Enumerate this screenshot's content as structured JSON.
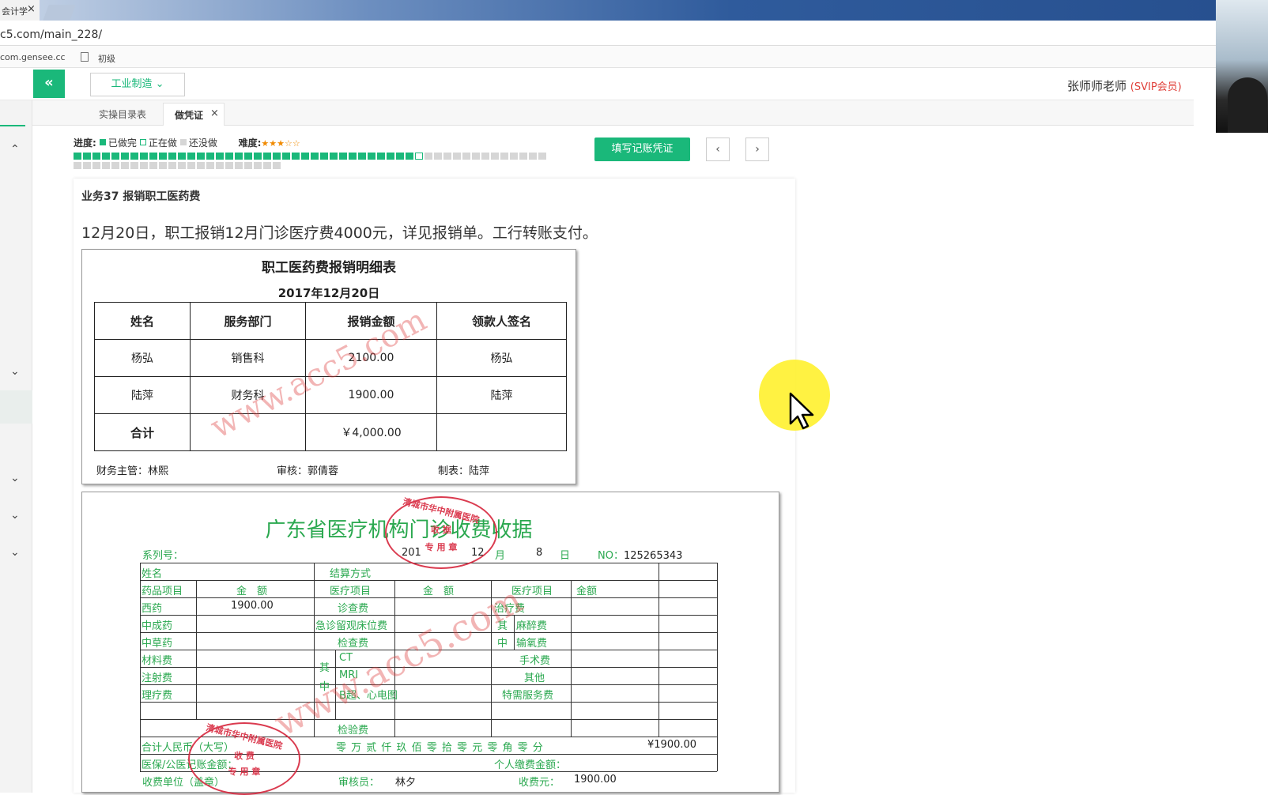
{
  "browser": {
    "tab_title": "会计学",
    "tab_close": "×",
    "url": "c5.com/main_228/",
    "bookmarks": [
      "com.gensee.cc",
      "初级"
    ]
  },
  "header": {
    "collapse_icon": "«",
    "industry": "工业制造",
    "teacher": "张师师老师",
    "vip": "(SVIP会员)"
  },
  "tabs": [
    {
      "label": "实操目录表"
    },
    {
      "label": "做凭证",
      "close": "×"
    }
  ],
  "progress": {
    "label": "进度:",
    "done": "已做完",
    "doing": "正在做",
    "todo": "还没做",
    "difficulty_label": "难度:",
    "difficulty_stars": "★★★☆☆",
    "total_cells": 72,
    "done_cells": 36,
    "current_cell": 37,
    "colors": {
      "done": "#1ab87a",
      "doing": "#ffffff",
      "todo": "#d6d6d6"
    }
  },
  "actions": {
    "fill_voucher": "填写记账凭证",
    "prev": "‹",
    "next": "›"
  },
  "task": {
    "title": "业务37 报销职工医药费",
    "description": "12月20日，职工报销12月门诊医疗费4000元，详见报销单。工行转账支付。"
  },
  "reimbursement_form": {
    "title": "职工医药费报销明细表",
    "date": "2017年12月20日",
    "headers": [
      "姓名",
      "服务部门",
      "报销金额",
      "领款人签名"
    ],
    "rows": [
      {
        "name": "杨弘",
        "dept": "销售科",
        "amount": "2100.00",
        "signature": "杨弘"
      },
      {
        "name": "陆萍",
        "dept": "财务科",
        "amount": "1900.00",
        "signature": "陆萍"
      }
    ],
    "total_label": "合计",
    "total_amount": "￥4,000.00",
    "footer": {
      "manager": "财务主管：林熙",
      "auditor": "审核：郭倩蓉",
      "preparer": "制表：陆萍"
    }
  },
  "receipt": {
    "title": "广东省医疗机构门诊收费收据",
    "serial_label": "系列号：",
    "year": "201",
    "month_val": "12",
    "month_label": "月",
    "day_val": "8",
    "day_label": "日",
    "no_label": "NO：",
    "no_value": "125265343",
    "name_label": "姓名",
    "settle_label": "结算方式",
    "drug_item": "药品项目",
    "amount_label": "金　额",
    "medical_item": "医疗项目",
    "amount_label2": "金　额",
    "medical_item2": "医疗项目",
    "amount_label3": "金额",
    "western": "西药",
    "western_amount": "1900.00",
    "chinese_patent": "中成药",
    "chinese_herbal": "中草药",
    "material": "材料费",
    "injection": "注射费",
    "therapy": "理疗费",
    "consult": "诊查费",
    "emergency_bed": "急诊留观床位费",
    "exam": "检查费",
    "qi": "其",
    "zhong": "中",
    "ct": "CT",
    "mri": "MRI",
    "bchao": "B超、心电图",
    "lab": "检验费",
    "treatment": "治疗费",
    "anesthesia": "麻醉费",
    "oxygen": "输氧费",
    "surgery": "手术费",
    "other": "其他",
    "special": "特需服务费",
    "total_rmb": "合计人民币（大写）",
    "total_caps": "零 万 贰 仟 玖 佰 零 拾 零 元 零 角 零 分",
    "total_num": "¥1900.00",
    "insurance": "医保/公医记账金额：",
    "personal": "个人缴费金额：",
    "payee_unit": "收费单位（盖章）",
    "auditor_label": "审核员：",
    "auditor": "林夕",
    "collector_label": "收费元：",
    "collector": "1900.00"
  },
  "stamps": {
    "top_ring": "清城市华中附属医院",
    "top_mid": "收 据",
    "top_bottom": "专 用 章",
    "bottom_ring": "清城市华中附属医院",
    "bottom_mid": "收 费",
    "bottom_bottom": "专 用 章"
  },
  "watermark": "www.acc5.com"
}
